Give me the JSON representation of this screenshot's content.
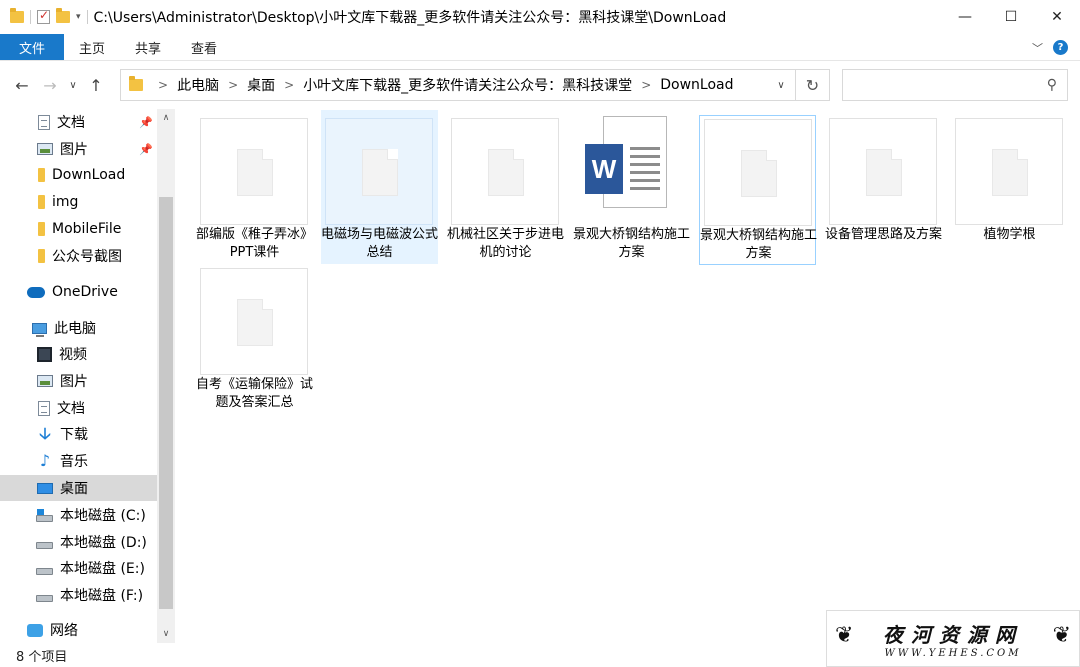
{
  "window": {
    "title": "C:\\Users\\Administrator\\Desktop\\小叶文库下载器_更多软件请关注公众号：黑科技课堂\\DownLoad"
  },
  "ribbon": {
    "file_tab": "文件",
    "tabs": [
      "主页",
      "共享",
      "查看"
    ]
  },
  "address": {
    "crumbs": [
      "此电脑",
      "桌面",
      "小叶文库下载器_更多软件请关注公众号：黑科技课堂",
      "DownLoad"
    ]
  },
  "search": {
    "placeholder": ""
  },
  "sidebar": {
    "items": [
      {
        "label": "文档",
        "icon": "document-icon",
        "pinned": true
      },
      {
        "label": "图片",
        "icon": "picture-icon",
        "pinned": true
      },
      {
        "label": "DownLoad",
        "icon": "folder-icon"
      },
      {
        "label": "img",
        "icon": "folder-icon"
      },
      {
        "label": "MobileFile",
        "icon": "folder-icon"
      },
      {
        "label": "公众号截图",
        "icon": "folder-icon"
      },
      {
        "label": "OneDrive",
        "icon": "onedrive-icon"
      },
      {
        "label": "此电脑",
        "icon": "computer-icon"
      },
      {
        "label": "视频",
        "icon": "video-icon"
      },
      {
        "label": "图片",
        "icon": "picture-icon"
      },
      {
        "label": "文档",
        "icon": "document-icon"
      },
      {
        "label": "下载",
        "icon": "download-icon"
      },
      {
        "label": "音乐",
        "icon": "music-icon"
      },
      {
        "label": "桌面",
        "icon": "desktop-icon",
        "selected": true
      },
      {
        "label": "本地磁盘 (C:)",
        "icon": "system-drive-icon"
      },
      {
        "label": "本地磁盘 (D:)",
        "icon": "drive-icon"
      },
      {
        "label": "本地磁盘 (E:)",
        "icon": "drive-icon"
      },
      {
        "label": "本地磁盘 (F:)",
        "icon": "drive-icon"
      },
      {
        "label": "网络",
        "icon": "network-icon"
      }
    ]
  },
  "files": [
    {
      "name": "部编版《稚子弄冰》PPT课件",
      "type": "blank"
    },
    {
      "name": "电磁场与电磁波公式总结",
      "type": "blank",
      "state": "hover"
    },
    {
      "name": "机械社区关于步进电机的讨论",
      "type": "blank"
    },
    {
      "name": "景观大桥钢结构施工方案",
      "type": "word"
    },
    {
      "name": "景观大桥钢结构施工方案",
      "type": "blank",
      "state": "focus"
    },
    {
      "name": "设备管理思路及方案",
      "type": "blank"
    },
    {
      "name": "植物学根",
      "type": "blank"
    },
    {
      "name": "自考《运输保险》试题及答案汇总",
      "type": "blank"
    }
  ],
  "status": {
    "item_count": "8 个项目"
  },
  "watermark": {
    "main": "夜河资源网",
    "sub": "WWW.YEHES.COM"
  },
  "colors": {
    "accent": "#1979ca",
    "selection": "#e5f3ff",
    "word": "#2b579a"
  }
}
